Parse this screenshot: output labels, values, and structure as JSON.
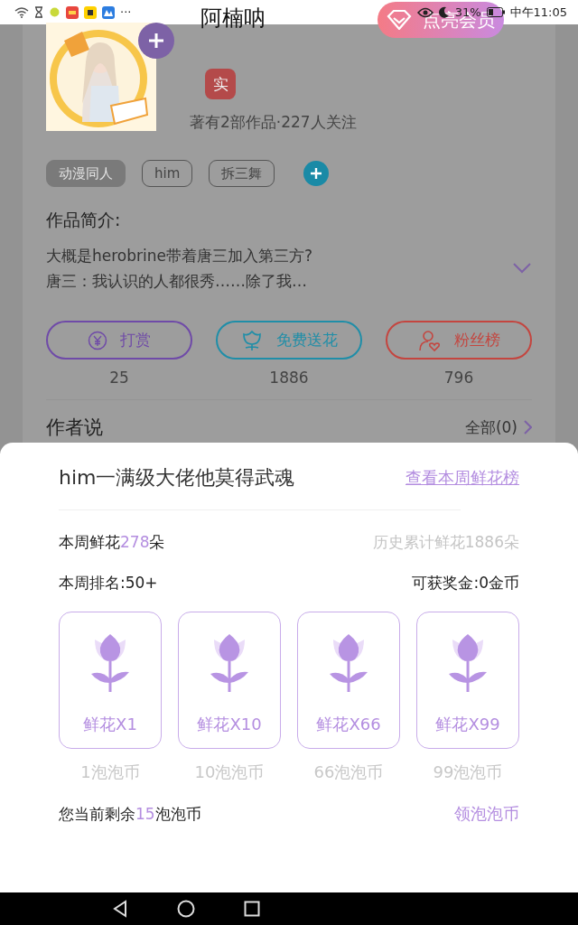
{
  "status_bar": {
    "more": "···",
    "battery": "31%",
    "time": "中午11:05"
  },
  "header": {
    "title": "阿楠呐",
    "member_button": "点亮会员"
  },
  "author": {
    "badge": "实",
    "stats": "著有2部作品·227人关注"
  },
  "tags": [
    {
      "label": "动漫同人",
      "kind": "filled"
    },
    {
      "label": "him",
      "kind": "outline"
    },
    {
      "label": "拆三舞",
      "kind": "outline"
    }
  ],
  "synopsis": {
    "heading": "作品简介:",
    "lines": [
      "大概是herobrine带着唐三加入第三方?",
      "唐三：我认识的人都很秀……除了我…"
    ],
    "expanded": false
  },
  "actions": [
    {
      "kind": "reward",
      "label": "打赏",
      "count": "25",
      "color": "#6f4aa8"
    },
    {
      "kind": "flower",
      "label": "免费送花",
      "count": "1886",
      "color": "#1f8ea8"
    },
    {
      "kind": "fans",
      "label": "粉丝榜",
      "count": "796",
      "color": "#c4453f"
    }
  ],
  "author_says": {
    "heading": "作者说",
    "all_link": "全部(0)"
  },
  "sheet": {
    "title": "him一满级大佬他莫得武魂",
    "rank_link": "查看本周鲜花榜",
    "weekly": {
      "prefix": "本周鲜花",
      "value": "278",
      "suffix": "朵"
    },
    "total": "历史累计鲜花1886朵",
    "rank": "本周排名:50+",
    "bonus": "可获奖金:0金币",
    "gifts": [
      {
        "label": "鲜花X1",
        "price": "1泡泡币"
      },
      {
        "label": "鲜花X10",
        "price": "10泡泡币"
      },
      {
        "label": "鲜花X66",
        "price": "66泡泡币"
      },
      {
        "label": "鲜花X99",
        "price": "99泡泡币"
      }
    ],
    "balance": {
      "prefix": "您当前剩余",
      "value": "15",
      "suffix": "泡泡币"
    },
    "earn_link": "领泡泡币"
  }
}
